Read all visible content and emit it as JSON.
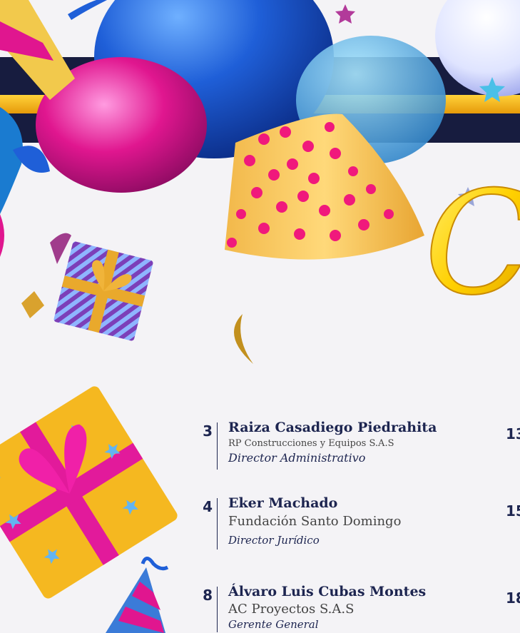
{
  "decor": {
    "gold": "#f5b820",
    "navy": "#171c3f",
    "magenta": "#e0168f",
    "blue": "#1f5fd8",
    "script_letter": "C"
  },
  "birthdays": [
    {
      "day": "3",
      "name": "Raiza Casadiego Piedrahita",
      "company": "RP Construcciones y Equipos S.A.S",
      "role": "Director Administrativo"
    },
    {
      "day": "4",
      "name": "Eker Machado",
      "company": "Fundación Santo Domingo",
      "role": "Director Jurídico"
    },
    {
      "day": "8",
      "name": "Álvaro Luis Cubas Montes",
      "company": "AC Proyectos S.A.S",
      "role": "Gerente General"
    }
  ],
  "right_days": [
    "13",
    "15",
    "18"
  ]
}
